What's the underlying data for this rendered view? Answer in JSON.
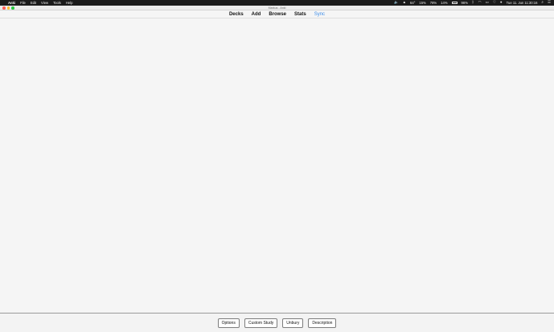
{
  "menubar": {
    "app_name": "Anki",
    "menus": [
      "File",
      "Edit",
      "View",
      "Tools",
      "Help"
    ],
    "status": {
      "temp": "64°",
      "cpu1": "15%",
      "cpu2": "78%",
      "cpu3": "14%",
      "battery": "96%",
      "datetime": "Tue 11. Jun  11:30:16"
    }
  },
  "window": {
    "title": "Markus - Anki"
  },
  "toolbar": {
    "decks": "Decks",
    "add": "Add",
    "browse": "Browse",
    "stats": "Stats",
    "sync": "Sync",
    "sync_color": "#3b8ce8"
  },
  "bottom": {
    "options": "Options",
    "custom_study": "Custom Study",
    "unbury": "Unbury",
    "description": "Description"
  },
  "icons": [
    "apple-icon",
    "volume-icon",
    "bluetooth-icon",
    "wifi-icon",
    "search-icon",
    "menu-icon"
  ]
}
